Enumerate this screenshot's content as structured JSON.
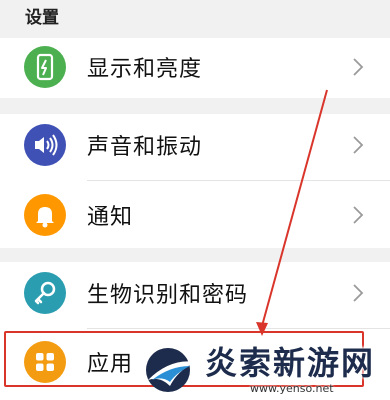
{
  "header": {
    "title": "设置"
  },
  "items": [
    {
      "label": "显示和亮度",
      "icon": "phone-brightness-icon",
      "color": "#4caf50"
    },
    {
      "label": "声音和振动",
      "icon": "speaker-icon",
      "color": "#3f51b5"
    },
    {
      "label": "通知",
      "icon": "bell-icon",
      "color": "#ff9800"
    },
    {
      "label": "生物识别和密码",
      "icon": "key-icon",
      "color": "#2a9db0"
    },
    {
      "label": "应用",
      "icon": "apps-grid-icon",
      "color": "#f39c12"
    }
  ],
  "annotation": {
    "color": "#d9352b"
  },
  "watermark": {
    "text": "炎索新游网",
    "url": "www.yenso.net"
  }
}
